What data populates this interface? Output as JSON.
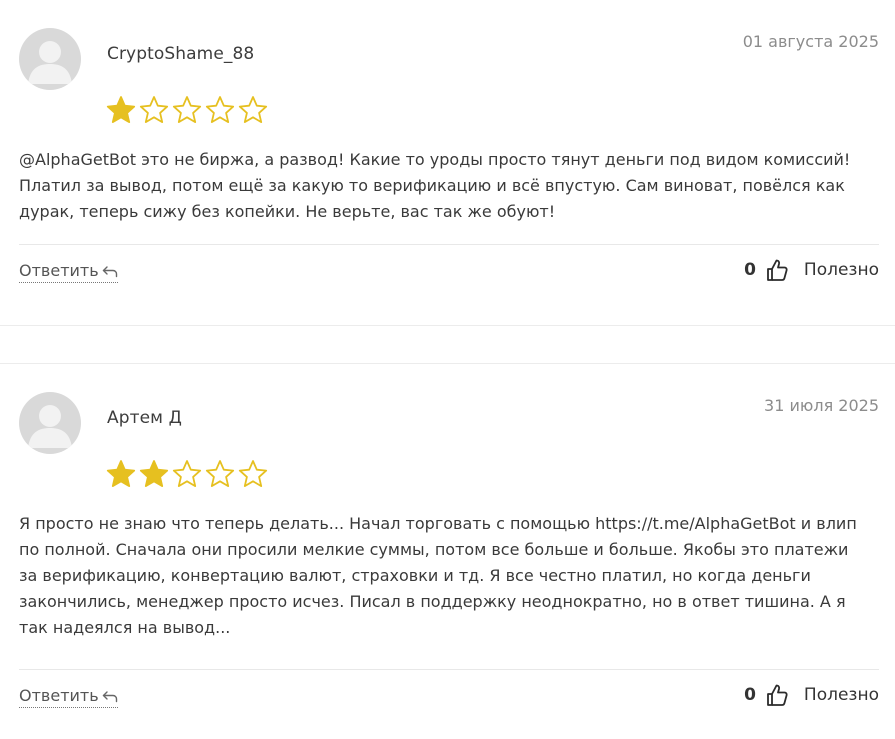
{
  "reviews": [
    {
      "author": "CryptoShame_88",
      "date": "01 августа 2025",
      "rating": 1,
      "rating_max": 5,
      "text": "@AlphaGetBot это не биржа, а развод! Какие то уроды просто тянут деньги под видом комиссий! Платил за вывод, потом ещё за какую то верификацию и всё впустую. Сам виноват, повёлся как дурак, теперь сижу без копейки. Не верьте, вас так же обуют!",
      "reply_label": "Ответить",
      "helpful_count": "0",
      "helpful_label": "Полезно"
    },
    {
      "author": "Артем Д",
      "date": "31 июля 2025",
      "rating": 2,
      "rating_max": 5,
      "text": "Я просто не знаю что теперь делать... Начал торговать с помощью https://t.me/AlphaGetBot и влип по полной. Сначала они просили мелкие суммы, потом все больше и больше. Якобы это платежи за верификацию, конвертацию валют, страховки и тд. Я все честно платил, но когда деньги закончились, менеджер просто исчез. Писал в поддержку неоднократно, но в ответ тишина. А я так надеялся на вывод...",
      "reply_label": "Ответить",
      "helpful_count": "0",
      "helpful_label": "Полезно"
    }
  ],
  "icons": {
    "avatar": "default-user-avatar-icon",
    "star_filled": "star-filled-icon",
    "star_empty": "star-outline-icon",
    "reply": "reply-arrow-icon",
    "helpful": "thumbs-up-icon"
  },
  "colors": {
    "star": "#e6c020",
    "avatar_bg": "#d9d9d9",
    "avatar_fg": "#f2f2f2",
    "date": "#8c8c8c",
    "divider": "#e8e8e8"
  }
}
